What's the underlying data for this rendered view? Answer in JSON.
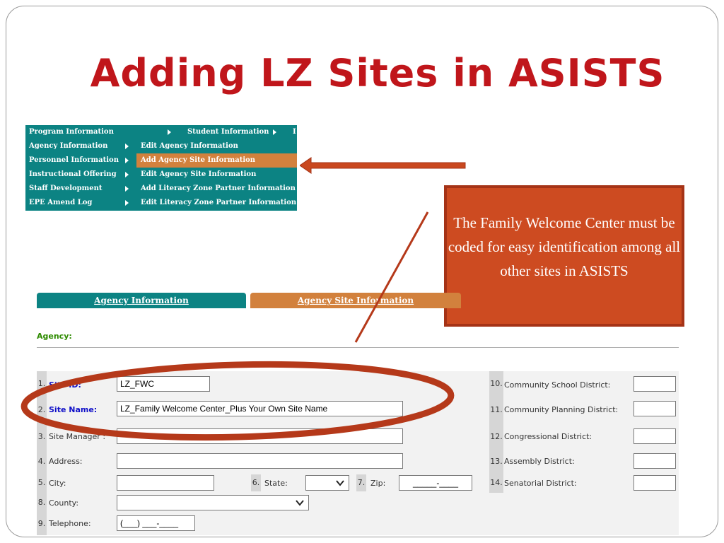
{
  "slide": {
    "title": "Adding LZ Sites in ASISTS"
  },
  "menu": {
    "top_right_item": "Student Information",
    "top_right_trunc": "I",
    "left_items": [
      "Program Information",
      "Agency Information",
      "Personnel Information",
      "Instructional Offering",
      "Staff Development",
      "EPE Amend Log"
    ],
    "submenu_items": [
      "Edit Agency Information",
      "Add Agency Site Information",
      "Edit Agency Site Information",
      "Add Literacy Zone Partner Information",
      "Edit Literacy Zone Partner Information"
    ],
    "highlight_color": "#d2813d",
    "menu_color": "#0c8383"
  },
  "callout": {
    "text": "The Family Welcome Center must be coded for easy identification among all other sites in ASISTS",
    "color": "#cd4b21"
  },
  "tabs": {
    "agency": "Agency Information",
    "site": "Agency Site Information"
  },
  "agency_label": "Agency:",
  "form": {
    "left": [
      {
        "num": "1.",
        "label": "Site ID:",
        "value": "LZ_FWC"
      },
      {
        "num": "2.",
        "label": "Site Name:",
        "value": "LZ_Family Welcome Center_Plus Your Own Site Name"
      },
      {
        "num": "3.",
        "label": "Site Manager :",
        "value": ""
      },
      {
        "num": "4.",
        "label": "Address:",
        "value": ""
      },
      {
        "num": "5.",
        "label": "City:",
        "value": ""
      },
      {
        "num": "8.",
        "label": "County:",
        "value": ""
      },
      {
        "num": "9.",
        "label": "Telephone:",
        "value": "(___) ___-____"
      }
    ],
    "state": {
      "num": "6.",
      "label": "State:"
    },
    "zip": {
      "num": "7.",
      "label": "Zip:",
      "value": "_____-____"
    },
    "right": [
      {
        "num": "10.",
        "label": "Community School District:"
      },
      {
        "num": "11.",
        "label": "Community Planning District:"
      },
      {
        "num": "12.",
        "label": "Congressional District:"
      },
      {
        "num": "13.",
        "label": "Assembly District:"
      },
      {
        "num": "14.",
        "label": "Senatorial District:"
      }
    ]
  },
  "annotations": {
    "ellipse_color": "#b5391a",
    "arrow_color": "#c9481f"
  }
}
